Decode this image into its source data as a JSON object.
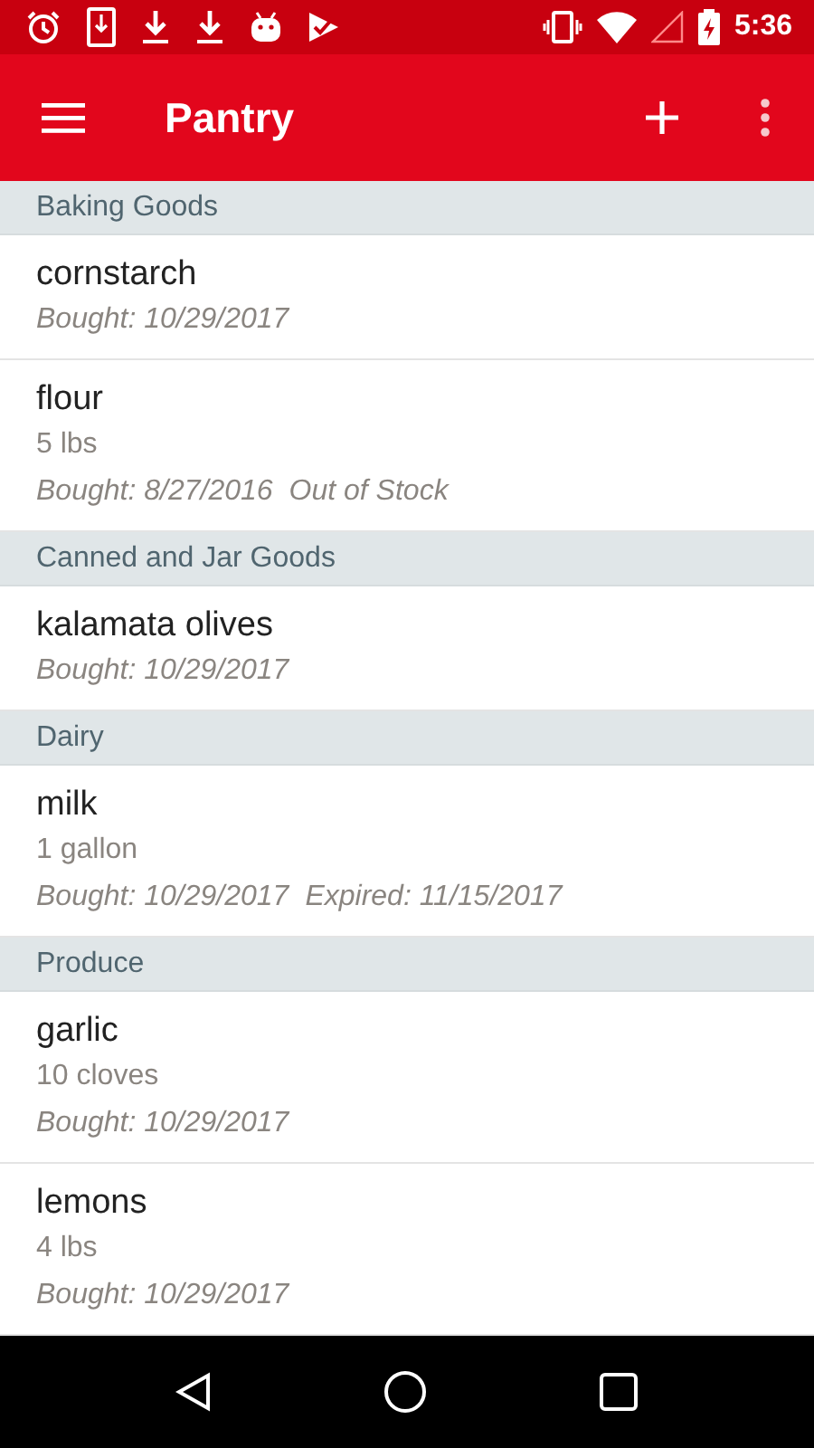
{
  "status_bar": {
    "time": "5:36"
  },
  "toolbar": {
    "title": "Pantry"
  },
  "sections": [
    {
      "title": "Baking Goods",
      "items": [
        {
          "name": "cornstarch",
          "bought": "Bought: 10/29/2017"
        },
        {
          "name": "flour",
          "quantity": "5 lbs",
          "bought": "Bought: 8/27/2016",
          "status": "Out of Stock"
        }
      ]
    },
    {
      "title": "Canned and Jar Goods",
      "items": [
        {
          "name": "kalamata olives",
          "bought": "Bought: 10/29/2017"
        }
      ]
    },
    {
      "title": "Dairy",
      "items": [
        {
          "name": "milk",
          "quantity": "1 gallon",
          "bought": "Bought: 10/29/2017",
          "status": "Expired: 11/15/2017"
        }
      ]
    },
    {
      "title": "Produce",
      "items": [
        {
          "name": "garlic",
          "quantity": "10 cloves",
          "bought": "Bought: 10/29/2017"
        },
        {
          "name": "lemons",
          "quantity": "4 lbs",
          "bought": "Bought: 10/29/2017"
        }
      ]
    }
  ]
}
